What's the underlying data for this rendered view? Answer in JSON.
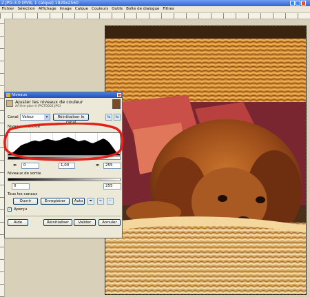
{
  "window": {
    "title": "Z.JPG-3.0 (RVB, 1 calque) 1929x2560"
  },
  "menu": [
    "Fichier",
    "Sélection",
    "Affichage",
    "Image",
    "Calque",
    "Couleurs",
    "Outils",
    "Boîte de dialogue",
    "Filtres"
  ],
  "dialog": {
    "title": "Niveaux",
    "heading": "Ajuster les niveaux de couleur",
    "subheading": "Arrière-plan-4 (PICT0002.JPG)",
    "canal_label": "Canal :",
    "canal_value": "Valeur",
    "reset_channel_label": "Réinitialiser le canal",
    "input_levels_label": "Niveaux d'entrée",
    "input_low": "0",
    "input_gamma": "1,00",
    "input_high": "255",
    "output_levels_label": "Niveaux de sortie",
    "output_low": "0",
    "output_high": "255",
    "all_channels_label": "Tous les canaux",
    "open_label": "Ouvrir",
    "save_label": "Enregistrer",
    "auto_label": "Auto",
    "preview_label": "Aperçu",
    "preview_checked": true,
    "help_label": "Aide",
    "reset_label": "Réinitialiser",
    "ok_label": "Valider",
    "cancel_label": "Annuler"
  },
  "histogram": [
    2,
    3,
    5,
    8,
    12,
    16,
    20,
    22,
    24,
    25,
    27,
    29,
    30,
    31,
    30,
    29,
    30,
    32,
    33,
    34,
    33,
    32,
    31,
    30,
    31,
    32,
    34,
    36,
    37,
    38,
    37,
    35,
    33,
    31,
    29,
    30,
    31,
    32,
    30,
    28,
    26,
    25,
    27,
    29,
    31,
    33,
    35,
    33,
    30,
    26,
    20,
    14,
    8,
    4,
    2
  ],
  "colors": {
    "annotation": "#e0201a",
    "title_bar": "#2f63d6"
  }
}
